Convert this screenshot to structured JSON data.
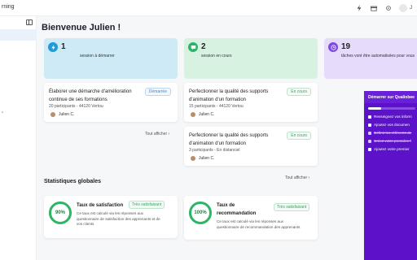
{
  "header": {
    "brand": "rning",
    "user_initial": "J"
  },
  "main": {
    "title": "Bienvenue Julien !",
    "stats": [
      {
        "number": "1",
        "label": "session à démarrer",
        "bg": "#cfeaf7",
        "icon_color": "#1f9ad6"
      },
      {
        "number": "2",
        "label": "session en cours",
        "bg": "#d7f2e1",
        "icon_color": "#2eb36a"
      },
      {
        "number": "19",
        "label": "tâches vont être automatisées pour vous",
        "bg": "#e6dbfa",
        "icon_color": "#7d4be3"
      }
    ],
    "sessions_left": [
      {
        "title": "Élaborer une démarche d'amélioration continue de ses formations",
        "meta": "20 participants - 44120 Vertou",
        "badge": "Démarrée",
        "person": "Julien C."
      }
    ],
    "sessions_right": [
      {
        "title": "Perfectionner la qualité des supports d'animation d'un formation",
        "meta": "15 participants - 44120 Vertou",
        "badge": "En cours",
        "person": "Julien C."
      },
      {
        "title": "Perfectionner la qualité des supports d'animation d'un formation",
        "meta": "3 participants - En distanciel",
        "badge": "En cours",
        "person": "Julien C."
      }
    ],
    "show_all": "Tout afficher ›",
    "section_title": "Statistiques globales",
    "metrics": [
      {
        "value": "90%",
        "title": "Taux de satisfaction",
        "badge": "Très satisfaisant",
        "desc": "Ce taux est calculé via les réponses aux questionnaire de satisfaction des apprenants et de vos clients"
      },
      {
        "value": "100%",
        "title": "Taux de recommandation",
        "badge": "Très satisfaisant",
        "desc": "Ce taux est calculé via les réponses aux questionnaire de recommandation des apprenants"
      }
    ]
  },
  "onboarding": {
    "title": "Démarrer sur Qualiobee",
    "progress": 0.28,
    "items": [
      {
        "label": "Renseignez vos inform",
        "done": false
      },
      {
        "label": "Ajoutez vos documen",
        "done": false
      },
      {
        "label": "Définir les référents de",
        "done": true
      },
      {
        "label": "Créez votre première f",
        "done": true
      },
      {
        "label": "Ajoutez votre premier",
        "done": false
      }
    ]
  }
}
